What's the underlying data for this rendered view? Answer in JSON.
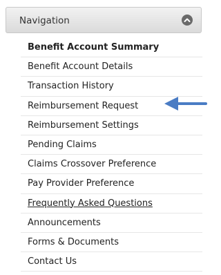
{
  "nav": {
    "title": "Navigation",
    "collapse_icon": "chevron-up-circle-icon",
    "items": [
      {
        "label": "Benefit Account Summary",
        "state": "active"
      },
      {
        "label": "Benefit Account Details"
      },
      {
        "label": "Transaction History"
      },
      {
        "label": "Reimbursement Request"
      },
      {
        "label": "Reimbursement Settings"
      },
      {
        "label": "Pending Claims"
      },
      {
        "label": "Claims Crossover Preference"
      },
      {
        "label": "Pay Provider Preference"
      },
      {
        "label": "Frequently Asked Questions",
        "state": "underlined"
      },
      {
        "label": "Announcements"
      },
      {
        "label": "Forms & Documents"
      },
      {
        "label": "Contact Us"
      }
    ]
  },
  "annotation": {
    "icon": "arrow-left-icon",
    "color": "#4a7cc4"
  }
}
